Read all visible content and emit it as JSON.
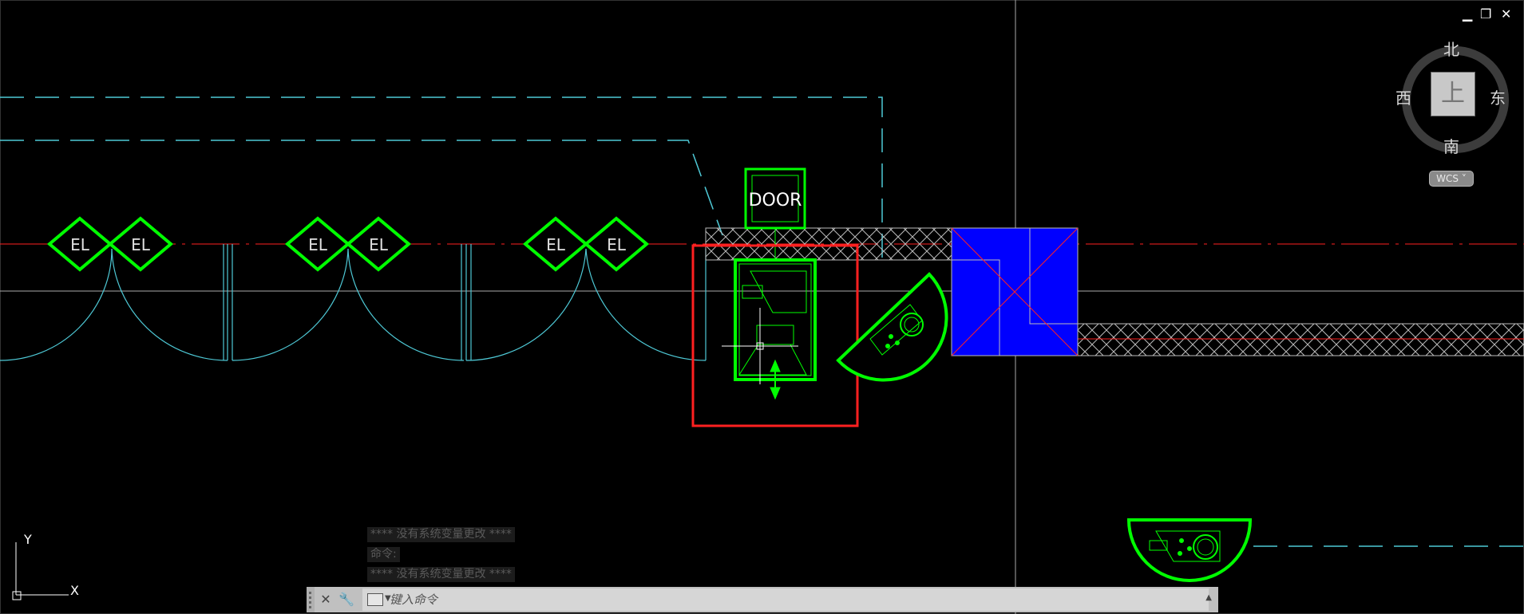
{
  "window_controls": {
    "minimize": "▁",
    "restore": "❐",
    "close": "✕"
  },
  "viewcube": {
    "north": "北",
    "south": "南",
    "east": "东",
    "west": "西",
    "face": "上",
    "wcs": "WCS ˅"
  },
  "drawing": {
    "el_label": "EL",
    "door_label": "DOOR",
    "ucs_x": "X",
    "ucs_y": "Y",
    "colors": {
      "green": "#00ff00",
      "cyan": "#4ec9d6",
      "red": "#ff2020",
      "blue": "#0000ff",
      "white": "#d0d0d0"
    }
  },
  "command_history": [
    "**** 没有系统变量更改 ****",
    "命令:",
    "**** 没有系统变量更改 ****"
  ],
  "command_line": {
    "placeholder": "键入命令"
  }
}
